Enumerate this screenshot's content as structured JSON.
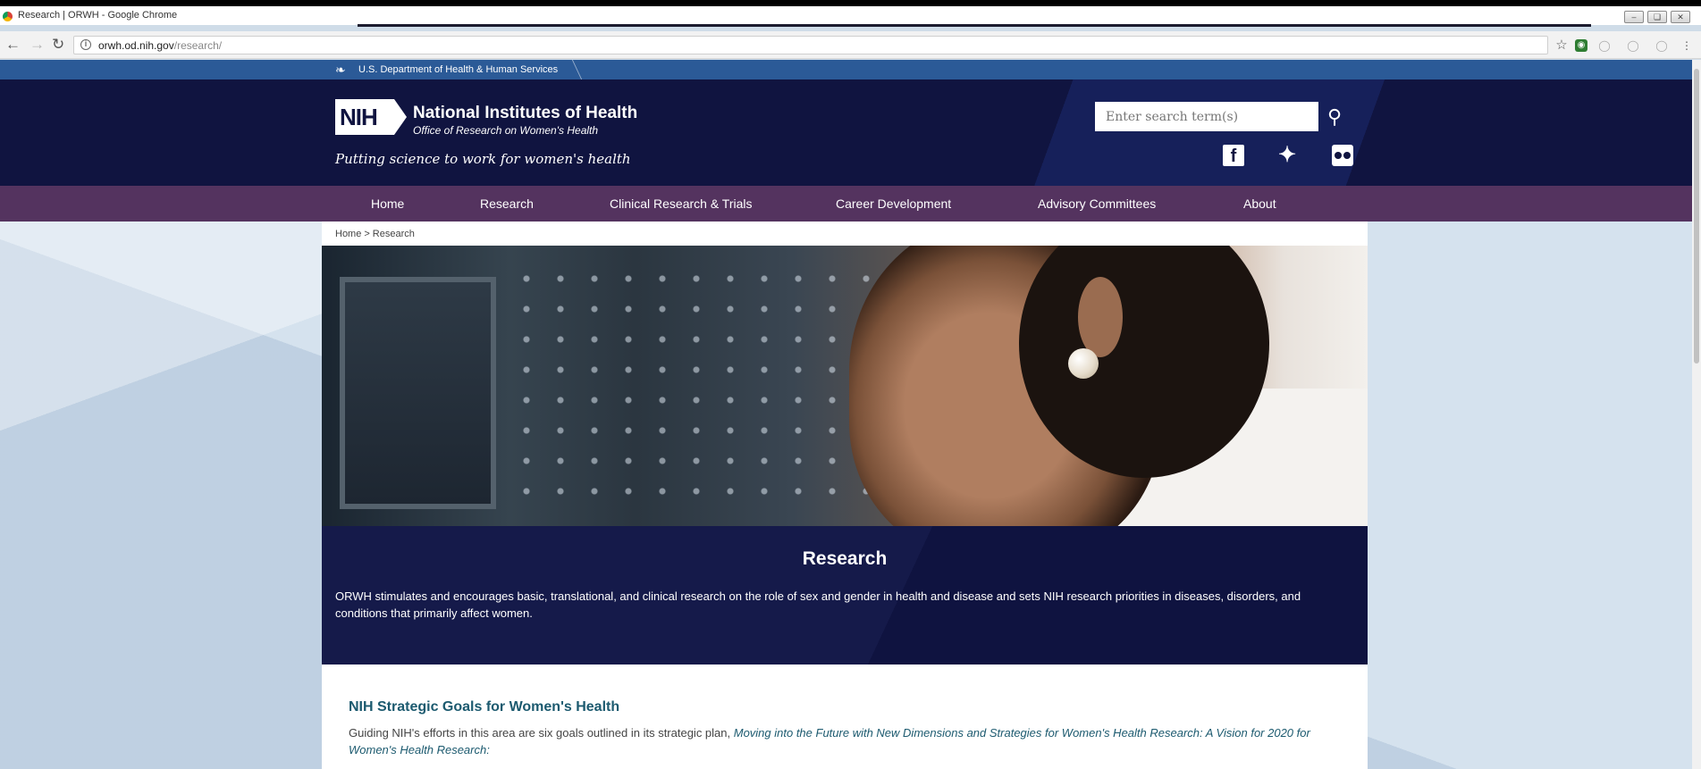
{
  "window": {
    "title": "Research | ORWH - Google Chrome"
  },
  "browser": {
    "url_host": "orwh.od.nih.gov",
    "url_path": "/research/"
  },
  "hhs": {
    "label": "U.S. Department of Health & Human Services"
  },
  "header": {
    "logo_abbr": "NIH",
    "org_name": "National Institutes of Health",
    "office_name": "Office of Research on Women's Health",
    "tagline": "Putting science to work for women's health",
    "search_placeholder": "Enter search term(s)"
  },
  "nav": {
    "items": [
      "Home",
      "Research",
      "Clinical Research & Trials",
      "Career Development",
      "Advisory Committees",
      "About"
    ]
  },
  "breadcrumb": {
    "home": "Home",
    "separator": ">",
    "current": "Research"
  },
  "intro": {
    "title": "Research",
    "text": "ORWH stimulates and encourages basic, translational, and clinical research on the role of sex and gender in health and disease and sets NIH research priorities in diseases, disorders, and conditions that primarily affect women."
  },
  "goals": {
    "title": "NIH Strategic Goals for Women's Health",
    "text_lead": "Guiding NIH's efforts in this area are six goals outlined in its strategic plan, ",
    "text_em": "Moving into the Future with New Dimensions and Strategies for Women's Health Research: A Vision for 2020 for Women's Health Research:"
  },
  "colors": {
    "hhs_bar": "#2b5a97",
    "masthead": "#101440",
    "nav_bar": "#54335f",
    "intro_bg": "#151a4a",
    "heading_teal": "#1c5a6f"
  },
  "icons": [
    "back-icon",
    "forward-icon",
    "reload-icon",
    "info-icon",
    "star-icon",
    "search-icon",
    "facebook-icon",
    "twitter-icon",
    "flickr-icon",
    "hhs-eagle-icon"
  ]
}
